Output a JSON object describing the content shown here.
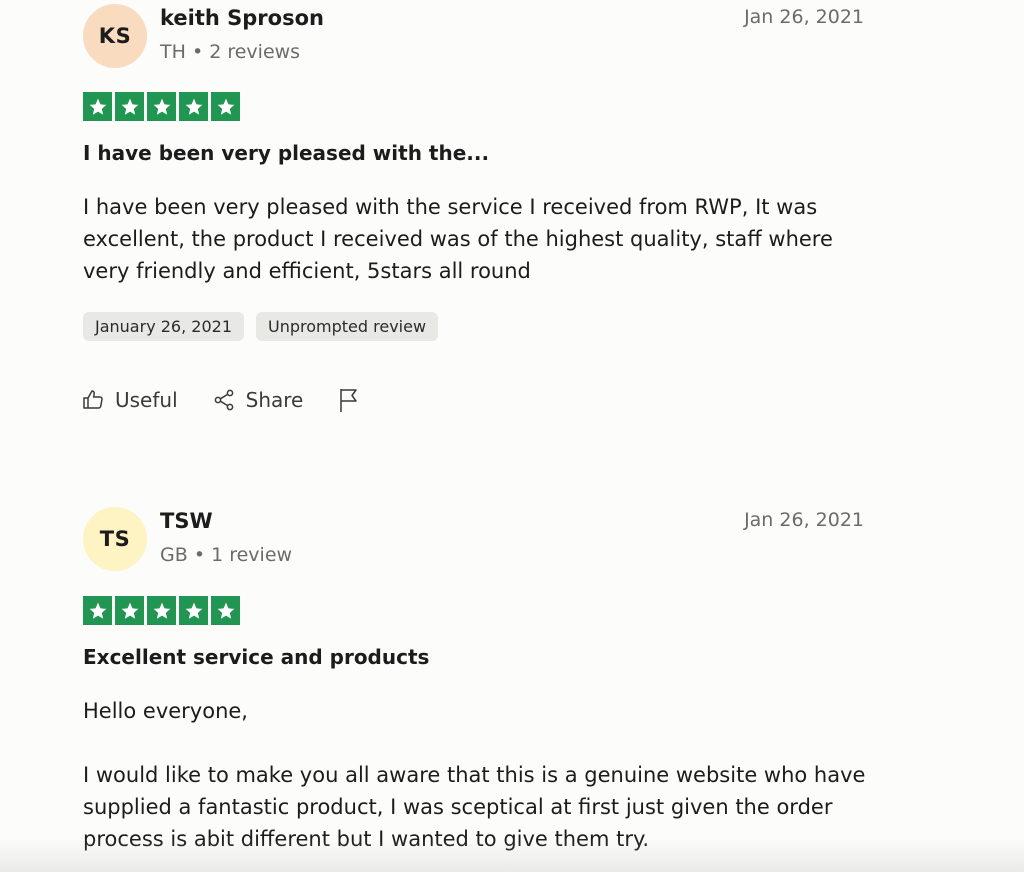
{
  "reviews": [
    {
      "initials": "KS",
      "avatar_color": "#f9dbbf",
      "name": "keith Sproson",
      "country": "TH",
      "review_count": "2 reviews",
      "date_short": "Jan 26, 2021",
      "stars": 5,
      "star_color": "#219653",
      "title": "I have been very pleased with the...",
      "body": [
        "I have been very pleased with the service I received from RWP, It was excellent, the product I received was of the highest quality, staff where very friendly and efficient, 5stars all round"
      ],
      "tags": [
        "January 26, 2021",
        "Unprompted review"
      ],
      "actions": {
        "useful": "Useful",
        "share": "Share",
        "report_icon": "flag-icon"
      }
    },
    {
      "initials": "TS",
      "avatar_color": "#fdf3c3",
      "name": "TSW",
      "country": "GB",
      "review_count": "1 review",
      "date_short": "Jan 26, 2021",
      "stars": 5,
      "star_color": "#219653",
      "title": "Excellent service and products",
      "body": [
        "Hello everyone,",
        "I would like to make you all aware that this is a genuine website who have supplied a fantastic product, I was sceptical at first just given the order process is abit different but I wanted to give them try."
      ]
    }
  ],
  "meta_separator": "•"
}
